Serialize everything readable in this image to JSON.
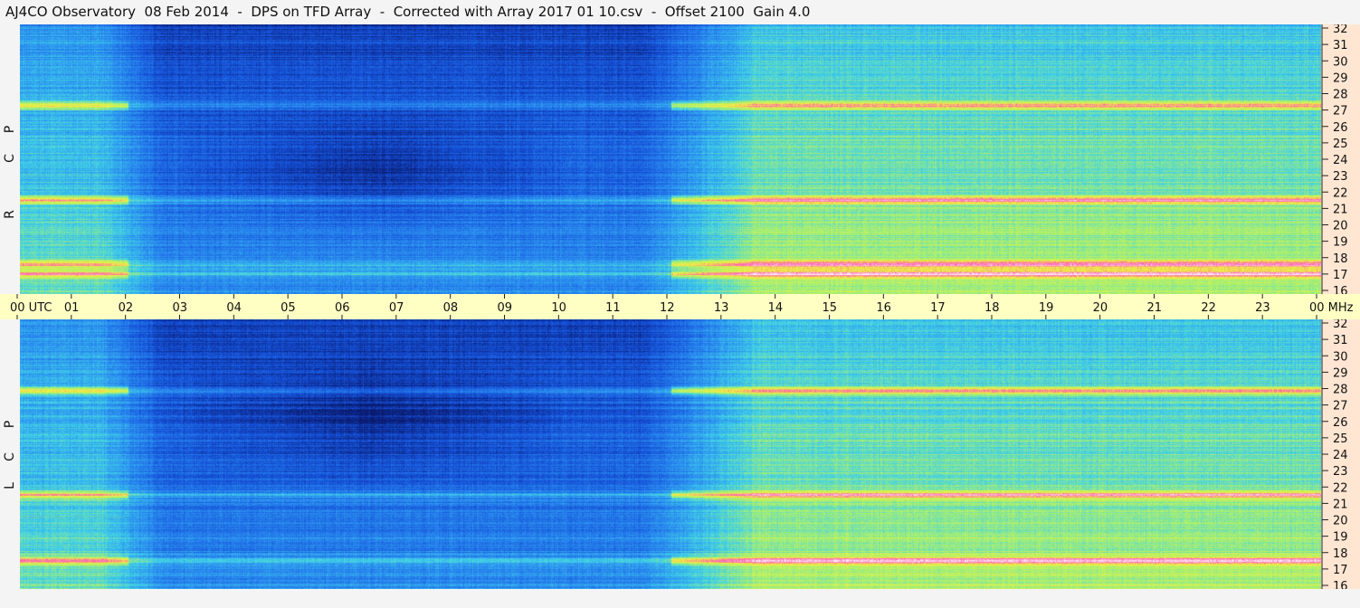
{
  "title": "AJ4CO Observatory  08 Feb 2014  -  DPS on TFD Array  -  Corrected with Array 2017 01 10.csv  -  Offset 2100  Gain 4.0",
  "chart_data": [
    {
      "type": "heatmap",
      "panel": "top",
      "ylabel": "R C P",
      "ylabel_letters": [
        "R",
        "C",
        "P"
      ],
      "x_ticks": [
        "00 UTC",
        "01",
        "02",
        "03",
        "04",
        "05",
        "06",
        "07",
        "08",
        "09",
        "10",
        "11",
        "12",
        "13",
        "14",
        "15",
        "16",
        "17",
        "18",
        "19",
        "20",
        "21",
        "22",
        "23",
        "00 MHz"
      ],
      "xlim": [
        0,
        24
      ],
      "y_ticks": [
        32,
        31,
        30,
        29,
        28,
        27,
        26,
        25,
        24,
        23,
        22,
        21,
        20,
        19,
        18,
        17,
        16
      ],
      "ylim": [
        16,
        32
      ],
      "y_unit": "MHz",
      "colormap": [
        "#0a1a6e",
        "#1550d8",
        "#2a8cf0",
        "#40d0e8",
        "#a8f070",
        "#f0f040",
        "#ff60b0",
        "#ffffff"
      ],
      "description_levels": {
        "quiet_hours_utc": [
          2,
          12
        ],
        "active_hours_utc": [
          13,
          24
        ],
        "bright_bands_mhz": [
          27.2,
          21.6,
          17.8,
          17.2
        ],
        "dark_band_mhz": 23.5
      }
    },
    {
      "type": "heatmap",
      "panel": "bottom",
      "ylabel": "L C P",
      "ylabel_letters": [
        "L",
        "C",
        "P"
      ],
      "xlim": [
        0,
        24
      ],
      "y_ticks": [
        32,
        31,
        30,
        29,
        28,
        27,
        26,
        25,
        24,
        23,
        22,
        21,
        20,
        19,
        18,
        17,
        16
      ],
      "ylim": [
        16,
        32
      ],
      "y_unit": "MHz",
      "colormap": [
        "#0a1a6e",
        "#1550d8",
        "#2a8cf0",
        "#40d0e8",
        "#a8f070",
        "#f0f040",
        "#ff60b0",
        "#ffffff"
      ],
      "description_levels": {
        "quiet_hours_utc": [
          2,
          12
        ],
        "active_hours_utc": [
          13,
          24
        ],
        "bright_bands_mhz": [
          27.8,
          21.6,
          17.7
        ],
        "dark_band_mhz": 26.2
      }
    }
  ]
}
